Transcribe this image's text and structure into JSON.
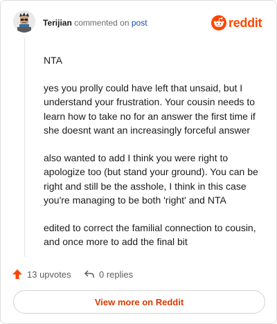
{
  "header": {
    "author": "Terijian",
    "action_text": "commented on",
    "post_link": "post",
    "brand_name": "reddit"
  },
  "comment": {
    "paragraphs": [
      "NTA",
      "yes you prolly could have left that unsaid, but I understand your frustration. Your cousin needs to learn how to take no for an answer the first time if she doesnt want an increasingly forceful answer",
      "also wanted to add I think you were right to apologize too (but stand your ground). You can be right and still be the asshole, I think in this case you're managing to be both 'right' and NTA",
      "edited to correct the familial connection to cousin, and once more to add the final bit"
    ]
  },
  "actions": {
    "upvotes_label": "13 upvotes",
    "replies_label": "0 replies"
  },
  "footer": {
    "view_more_label": "View more on Reddit"
  },
  "colors": {
    "brand": "#ff4500",
    "link": "#0a4fb5",
    "view_more_text": "#d93a00"
  }
}
